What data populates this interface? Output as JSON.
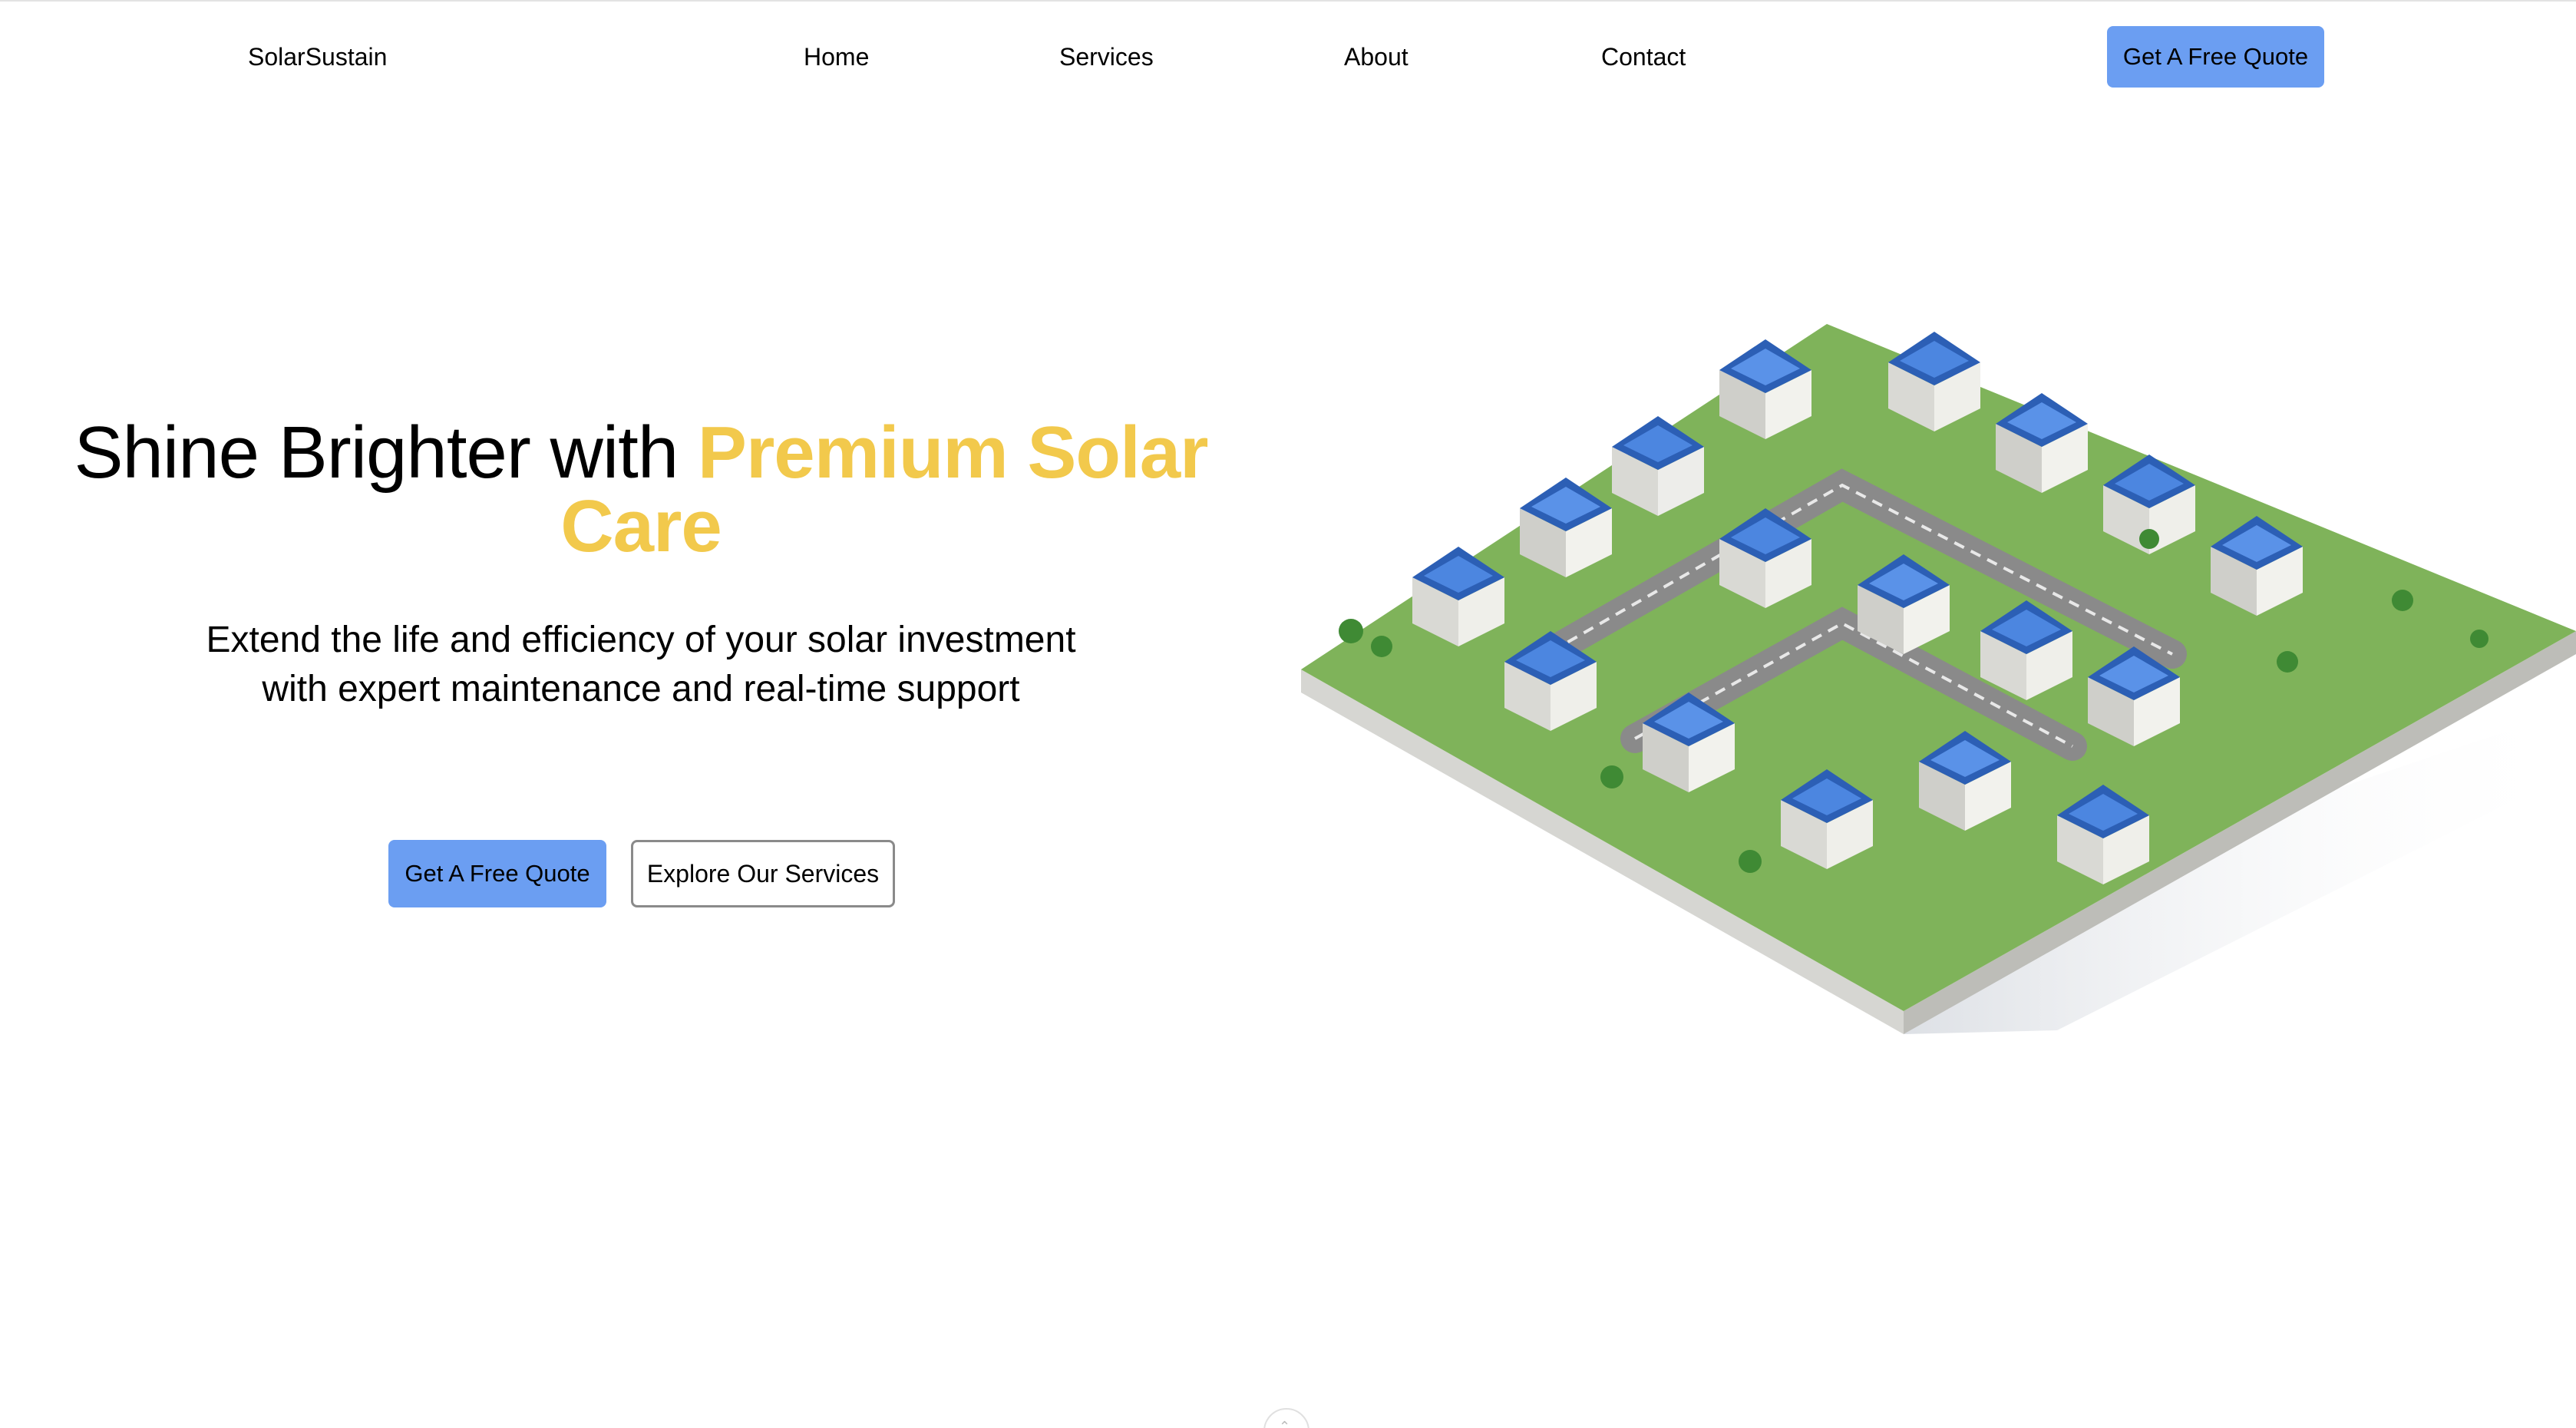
{
  "nav": {
    "brand": "SolarSustain",
    "links": [
      "Home",
      "Services",
      "About",
      "Contact"
    ],
    "cta_label": "Get A Free Quote",
    "cta_color": "#6b9ef2"
  },
  "hero": {
    "title_plain": "Shine Brighter with ",
    "title_accent": "Premium Solar Care",
    "accent_color": "#f2c94c",
    "subtitle_line1": "Extend the life and efficiency of your solar investment",
    "subtitle_line2": "with expert maintenance and real-time support",
    "primary_cta": "Get A Free Quote",
    "secondary_cta": "Explore Our Services",
    "image_icon": "isometric-solar-neighborhood-illustration"
  },
  "scroll": {
    "icon": "chevron-up-icon"
  }
}
